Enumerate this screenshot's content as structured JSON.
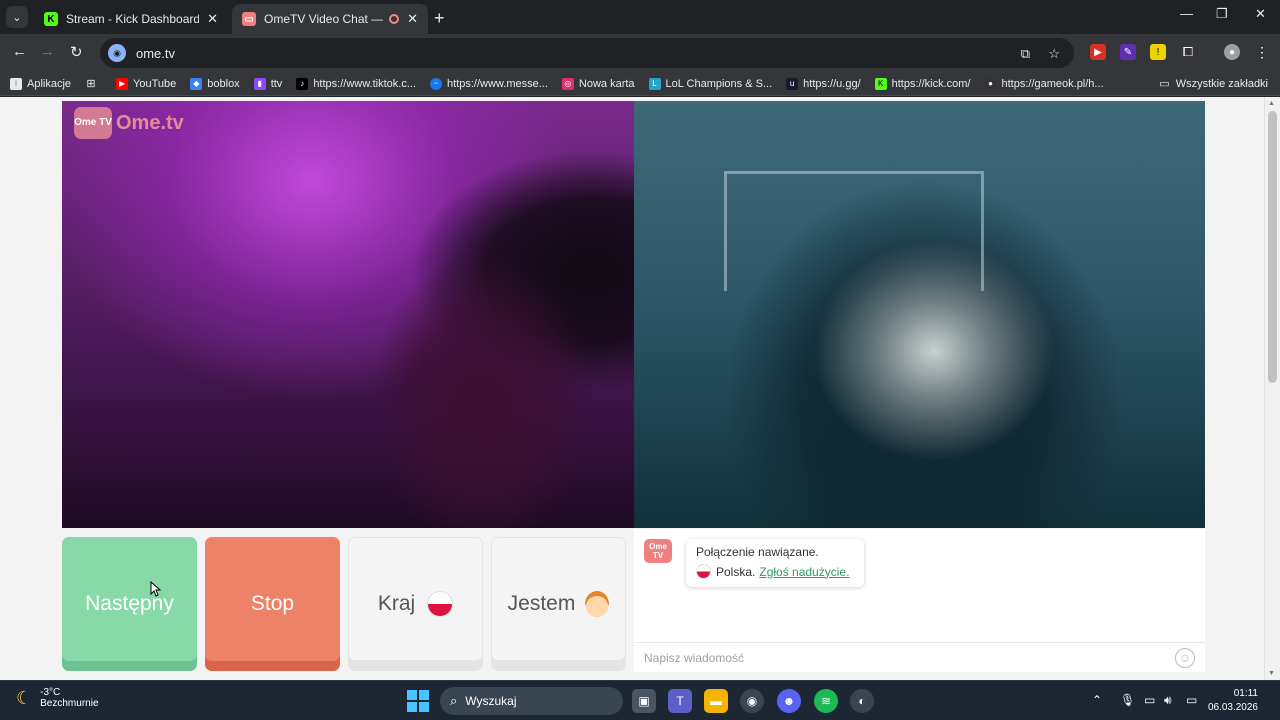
{
  "browser": {
    "tabs": [
      {
        "title": "Stream - Kick Dashboard",
        "favicon": "kick-icon",
        "active": false
      },
      {
        "title": "OmeTV Video Chat — Om",
        "favicon": "ometv-icon",
        "active": true,
        "recording": true
      }
    ],
    "address": "ome.tv",
    "bookmarks": [
      {
        "label": "Aplikacje",
        "icon": "apps-grid-icon"
      },
      {
        "label": "",
        "icon": "tab-grid-icon"
      },
      {
        "label": "YouTube",
        "icon": "youtube-icon",
        "color": "#ff0000"
      },
      {
        "label": "boblox",
        "icon": "roblox-icon",
        "color": "#3b82f6"
      },
      {
        "label": "ttv",
        "icon": "twitch-icon",
        "color": "#9146ff"
      },
      {
        "label": "https://www.tiktok.c...",
        "icon": "tiktok-icon",
        "color": "#000000"
      },
      {
        "label": "https://www.messe...",
        "icon": "messenger-icon",
        "color": "#1877f2"
      },
      {
        "label": "Nowa karta",
        "icon": "instagram-icon",
        "color": "#e1306c"
      },
      {
        "label": "LoL Champions & S...",
        "icon": "lol-icon",
        "color": "#2aa3c9"
      },
      {
        "label": "https://u.gg/",
        "icon": "ugg-icon",
        "color": "#1a1a2e"
      },
      {
        "label": "https://kick.com/",
        "icon": "kick-icon",
        "color": "#53fc18"
      },
      {
        "label": "https://gameok.pl/h...",
        "icon": "github-icon",
        "color": "#333333"
      }
    ],
    "all_bookmarks": "Wszystkie zakładki"
  },
  "ometv": {
    "logo_text": "Ome.tv",
    "logo_badge": "Ome TV",
    "buttons": {
      "next": "Następny",
      "stop": "Stop",
      "country": "Kraj",
      "gender": "Jestem"
    },
    "chat": {
      "system_line1": "Połączenie nawiązane.",
      "system_country": "Polska.",
      "report_link": "Zgłoś nadużycie.",
      "input_placeholder": "Napisz wiadomość"
    }
  },
  "taskbar": {
    "weather_temp": "-3°C",
    "weather_desc": "Bezchmurnie",
    "search_label": "Wyszukaj",
    "time": "01:11",
    "date": "06.03.2026"
  },
  "colors": {
    "next_button": "#88d9a8",
    "stop_button": "#ee8268",
    "report_link": "#2e9b5e"
  }
}
